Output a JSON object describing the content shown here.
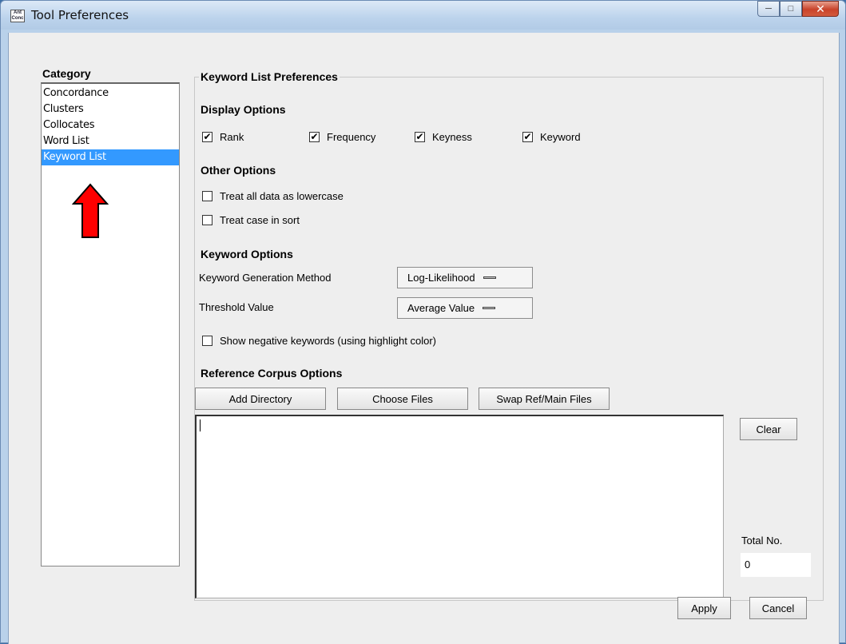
{
  "window": {
    "title": "Tool Preferences",
    "icon_text": "Ant\nConc"
  },
  "category": {
    "title": "Category",
    "items": [
      "Concordance",
      "Clusters",
      "Collocates",
      "Word List",
      "Keyword List"
    ],
    "selected": "Keyword List"
  },
  "panel": {
    "title": "Keyword List Preferences",
    "display_options": {
      "title": "Display Options",
      "items": [
        {
          "label": "Rank",
          "checked": true
        },
        {
          "label": "Frequency",
          "checked": true
        },
        {
          "label": "Keyness",
          "checked": true
        },
        {
          "label": "Keyword",
          "checked": true
        }
      ]
    },
    "other_options": {
      "title": "Other Options",
      "items": [
        {
          "label": "Treat all data as lowercase",
          "checked": false
        },
        {
          "label": "Treat case in sort",
          "checked": false
        }
      ]
    },
    "keyword_options": {
      "title": "Keyword Options",
      "method_label": "Keyword Generation Method",
      "method_value": "Log-Likelihood",
      "threshold_label": "Threshold Value",
      "threshold_value": "Average Value",
      "negative_label": "Show negative keywords (using highlight color)",
      "negative_checked": false
    },
    "reference": {
      "title": "Reference Corpus Options",
      "add_directory": "Add Directory",
      "choose_files": "Choose Files",
      "swap_files": "Swap Ref/Main Files",
      "clear": "Clear",
      "total_label": "Total No.",
      "total_value": "0"
    }
  },
  "footer": {
    "apply": "Apply",
    "cancel": "Cancel"
  },
  "colors": {
    "selection": "#3399ff",
    "arrow": "#ff0000"
  }
}
